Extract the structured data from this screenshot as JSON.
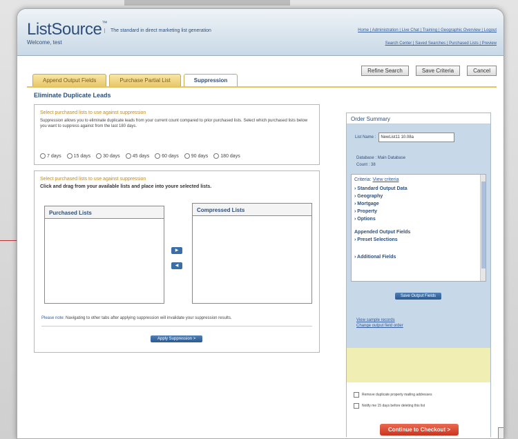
{
  "header": {
    "logo": "ListSource",
    "logo_mark": "™",
    "tagline": "The standard in direct marketing list generation",
    "welcome": "Welcome, test",
    "links1": "Home | Administration | Live Chat | Training | Geographic Overview | Logout",
    "links2": "Search Center | Saved Searches | Purchased Lists | Preview"
  },
  "actions": {
    "refine": "Refine Search",
    "save_criteria": "Save Criteria",
    "cancel": "Cancel"
  },
  "tabs": [
    {
      "label": "Append Output Fields"
    },
    {
      "label": "Purchase Partial List"
    },
    {
      "label": "Suppression"
    }
  ],
  "section_title": "Eliminate Duplicate Leads",
  "suppression": {
    "heading": "Select purchased lists to use against suppression",
    "desc": "Suppression allows you to eliminate duplicate leads from your current count compared to prior purchased lists. Select which purchased lists below you want to suppress against from the last 180 days.",
    "options": [
      "7 days",
      "15 days",
      "30 days",
      "45 days",
      "60 days",
      "90 days",
      "180 days"
    ]
  },
  "lists": {
    "heading": "Select purchased lists to use against suppression",
    "instruction": "Click and drag from your available lists and place into youre selected lists.",
    "purchased": "Purchased Lists",
    "compressed": "Compressed Lists",
    "note_label": "Please note:",
    "note": "Navigating to other tabs after applying suppression will invalidate your suppression results.",
    "apply": "Apply Suppression >"
  },
  "summary": {
    "title": "Order Summary",
    "list_name_label": "List Name :",
    "list_name_value": "NewList11 10.08a",
    "database_label": "Database :",
    "database_value": "Main Database",
    "count_label": "Count :",
    "count_value": "38",
    "criteria_label": "Criteria:",
    "criteria_link": "View criteria",
    "items": [
      "Standard Output Data",
      "Geography",
      "Mortgage",
      "Property",
      "Options"
    ],
    "appended": "Appended Output Fields",
    "preset": "Preset Selections",
    "additional": "Additional Fields",
    "save_output": "Save Output Fields",
    "view_sample": "View sample records",
    "change_order": "Change output field order",
    "chk1": "Remove duplicate property mailing addresses",
    "chk2": "Notify me 15 days before deleting this list",
    "checkout": "Continue to Checkout >"
  }
}
